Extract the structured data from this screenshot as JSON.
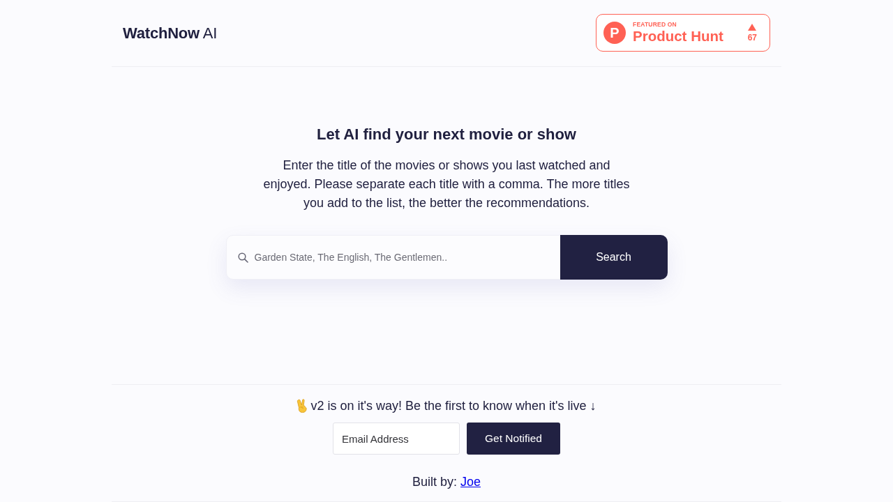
{
  "header": {
    "brand": "**WatchNow** AI",
    "badge": {
      "logo_letter": "P",
      "kicker": "FEATURED ON",
      "name": "Product Hunt",
      "upvote_count": "67"
    }
  },
  "hero": {
    "title": "Let AI find your next movie or show",
    "description": "Enter the title of the movies or shows you last watched and enjoyed. Please separate each title with a comma. The more titles you add to the list, the better the recommendations.",
    "search": {
      "placeholder": "Garden State, The English, The Gentlemen..",
      "button": "Search"
    }
  },
  "newsletter": {
    "message": "v2 is on it's way! Be the first to know when it's live ↓",
    "email_field": {
      "placeholder": "Email Address"
    },
    "button": "Get Notified"
  },
  "footer": {
    "credit_label": "Built by:",
    "credit_link": "Joe"
  }
}
